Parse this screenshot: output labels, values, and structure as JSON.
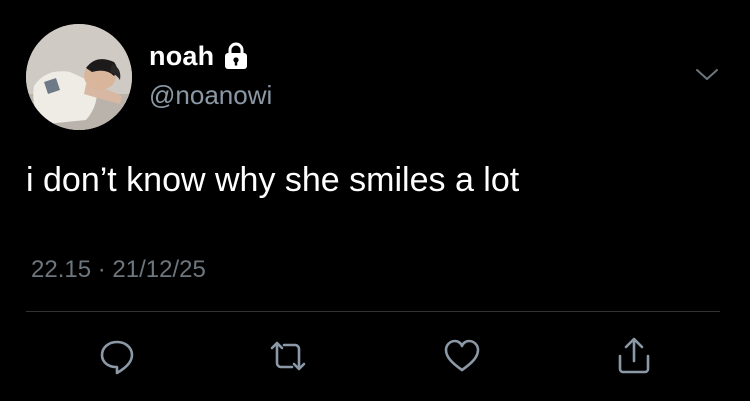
{
  "author": {
    "display_name": "noah",
    "handle": "@noanowi",
    "protected_icon": "lock-icon",
    "avatar": "profile-photo"
  },
  "tweet": {
    "text": "i don’t know why she smiles a lot",
    "timestamp": "22.15 · 21/12/25"
  },
  "menu_icon": "chevron-down-icon",
  "actions": [
    {
      "name": "reply",
      "icon": "reply-icon"
    },
    {
      "name": "retweet",
      "icon": "retweet-icon"
    },
    {
      "name": "like",
      "icon": "heart-icon"
    },
    {
      "name": "share",
      "icon": "share-icon"
    }
  ],
  "colors": {
    "background": "#000000",
    "primary_text": "#ffffff",
    "secondary_text": "#8b98a5",
    "icon": "#8b98a5",
    "divider": "#2f3336"
  }
}
